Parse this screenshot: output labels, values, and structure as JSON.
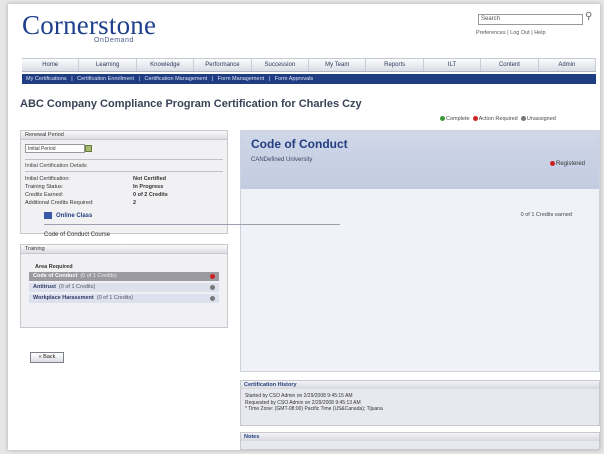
{
  "header": {
    "logo_main": "Cornerstone",
    "logo_sub": "OnDemand",
    "search_placeholder": "Search",
    "util_links": "Preferences | Log Out | Help"
  },
  "nav": {
    "main": [
      "Home",
      "Learning",
      "Knowledge",
      "Performance",
      "Succession",
      "My Team",
      "Reports",
      "ILT",
      "Content",
      "Admin"
    ],
    "sub": [
      "My Certifications",
      "|",
      "Certification Enrollment",
      "|",
      "Certification Management",
      "|",
      "Form Management",
      "|",
      "Form Approvals"
    ]
  },
  "page": {
    "title": "ABC Company Compliance Program Certification for Charles Czy"
  },
  "legend": {
    "items": [
      {
        "label": "Complete",
        "color": "#3a9a3a"
      },
      {
        "label": "Action Required",
        "color": "#cc2222"
      },
      {
        "label": "Unassigned",
        "color": "#777777"
      }
    ]
  },
  "left_panel": {
    "header": "Renewal Period",
    "period_value": "Initial Period",
    "section_title": "Initial Certification Details",
    "details": [
      {
        "k": "Initial Certification:",
        "v": "Not Certified"
      },
      {
        "k": "Training Status:",
        "v": "In Progress"
      },
      {
        "k": "Credits Earned:",
        "v": "0 of 2 Credits"
      },
      {
        "k": "Additional Credits Required:",
        "v": "2"
      }
    ]
  },
  "training": {
    "header": "Training",
    "required_title": "Area Required",
    "items": [
      {
        "name": "Code of Conduct",
        "sub": "(0 of 1 Credits)",
        "status_color": "#cc2222"
      },
      {
        "name": "Antitrust",
        "sub": "(0 of 1 Credits)",
        "status_color": "#777777"
      },
      {
        "name": "Workplace Harassment",
        "sub": "(0 of 1 Credits)",
        "status_color": "#777777"
      }
    ]
  },
  "back_button": "« Back",
  "main": {
    "title": "Code of Conduct",
    "subtitle": "CANDefined University",
    "required_label": "Registered",
    "online_label": "Online Class",
    "credits_label": "0 of 1 Credits earned",
    "course": "Code of Conduct Course"
  },
  "history": {
    "title": "Certification History",
    "lines": [
      "Started by CSO Admin on 2/29/2008 9:45:15 AM",
      "Requested by CSO Admin on 2/29/2008 9:45:13 AM",
      "* Time Zone: (GMT-08:00) Pacific Time (US&Canada); Tijuana"
    ]
  },
  "notes": {
    "title": "Notes"
  }
}
